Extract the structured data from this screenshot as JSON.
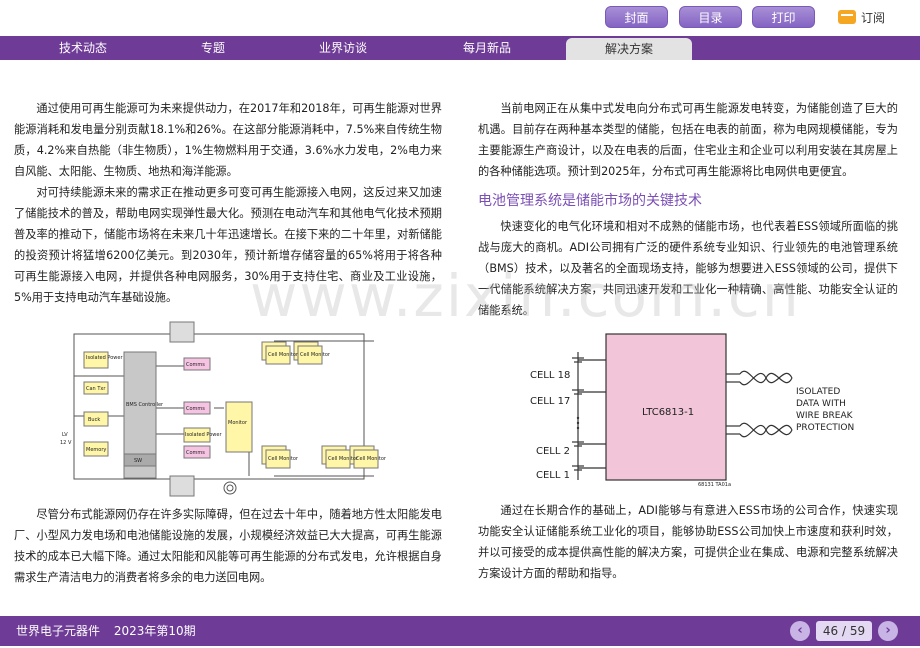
{
  "toolbar": {
    "cover_label": "封面",
    "toc_label": "目录",
    "print_label": "打印",
    "subscribe_label": "订阅"
  },
  "nav": {
    "items": [
      {
        "label": "技术动态"
      },
      {
        "label": "专题"
      },
      {
        "label": "业界访谈"
      },
      {
        "label": "每月新品"
      },
      {
        "label": "解决方案"
      }
    ],
    "active_index": 4
  },
  "article": {
    "left_paragraphs": [
      "通过使用可再生能源可为未来提供动力，在2017年和2018年，可再生能源对世界能源消耗和发电量分别贡献18.1%和26%。在这部分能源消耗中，7.5%来自传统生物质，4.2%来自热能（非生物质），1%生物燃料用于交通，3.6%水力发电，2%电力来自风能、太阳能、生物质、地热和海洋能源。",
      "对可持续能源未来的需求正在推动更多可变可再生能源接入电网，这反过来又加速了储能技术的普及，帮助电网实现弹性最大化。预测在电动汽车和其他电气化技术预期普及率的推动下，储能市场将在未来几十年迅速增长。在接下来的二十年里，对新储能的投资预计将猛增6200亿美元。到2030年，预计新增存储容量的65%将用于将各种可再生能源接入电网，并提供各种电网服务，30%用于支持住宅、商业及工业设施，5%用于支持电动汽车基础设施。"
    ],
    "left_bottom_paragraph": "尽管分布式能源网仍存在许多实际障碍，但在过去十年中，随着地方性太阳能发电厂、小型风力发电场和电池储能设施的发展，小规模经济效益已大大提高，可再生能源技术的成本已大幅下降。通过太阳能和风能等可再生能源的分布式发电，允许根据自身需求生产清洁电力的消费者将多余的电力送回电网。",
    "right_top_paragraph": "当前电网正在从集中式发电向分布式可再生能源发电转变，为储能创造了巨大的机遇。目前存在两种基本类型的储能，包括在电表的前面，称为电网规模储能，专为主要能源生产商设计，以及在电表的后面，住宅业主和企业可以利用安装在其房屋上的各种储能选项。预计到2025年，分布式可再生能源将比电网供电更便宜。",
    "section_heading": "电池管理系统是储能市场的关键技术",
    "right_mid_paragraph": "快速变化的电气化环境和相对不成熟的储能市场，也代表着ESS领域所面临的挑战与庞大的商机。ADI公司拥有广泛的硬件系统专业知识、行业领先的电池管理系统（BMS）技术，以及著名的全面现场支持，能够为想要进入ESS领域的公司，提供下一代储能系统解决方案，共同迅速开发和工业化一种精确、高性能、功能安全认证的储能系统。",
    "right_bottom_paragraph": "通过在长期合作的基础上，ADI能够与有意进入ESS市场的公司合作，快速实现功能安全认证储能系统工业化的项目，能够协助ESS公司加快上市速度和获利时效，并以可接受的成本提供高性能的解决方案，可提供企业在集成、电源和完整系统解决方案设计方面的帮助和指导。"
  },
  "watermark": "www.zixin.com.cn",
  "figure1": {
    "labels": {
      "isolated_power": "Isolated Power",
      "can_txr": "Can Txr",
      "buck": "Buck",
      "memory": "Memory",
      "lv": "LV",
      "v12": "12 V",
      "bms": "BMS Controller",
      "sw": "SW",
      "comms": "Comms",
      "isolated_power2": "Isolated Power",
      "monitor": "Monitor",
      "cell_monitor": "Cell Monitor"
    }
  },
  "figure2": {
    "cells": [
      "CELL 18",
      "CELL 17",
      "CELL 2",
      "CELL 1"
    ],
    "chip": "LTC6813-1",
    "note_lines": [
      "ISOLATED",
      "DATA WITH",
      "WIRE BREAK",
      "PROTECTION"
    ],
    "code": "68131 TA01a"
  },
  "footer": {
    "publication": "世界电子元器件",
    "issue": "2023年第10期",
    "page_indicator": "46 / 59",
    "prev": "‹",
    "next": "›"
  },
  "colors": {
    "brand_purple": "#6e3b96",
    "button_purple": "#8464c3",
    "heading_purple": "#7b4fb5",
    "chip_pink": "#f2c6d8"
  }
}
